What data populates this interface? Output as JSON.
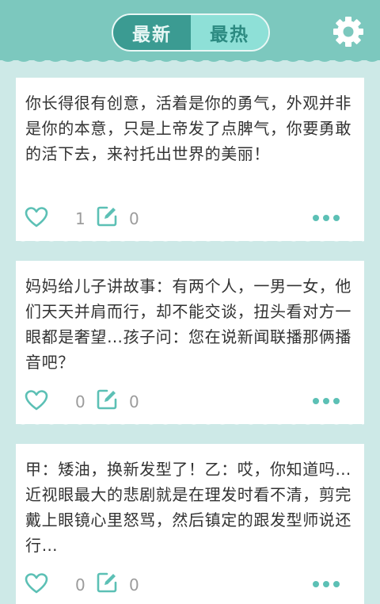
{
  "header": {
    "tabs": [
      {
        "label": "最新",
        "active": false
      },
      {
        "label": "最热",
        "active": true
      }
    ],
    "settings_icon": "gear-icon"
  },
  "colors": {
    "header_bg": "#7cc8be",
    "page_bg": "#cde9e7",
    "accent": "#5cc0b5",
    "tab_inactive_bg": "#3b9b92",
    "tab_active_bg": "#8ee0d7"
  },
  "posts": [
    {
      "text": "你长得很有创意，活着是你的勇气，外观并非是你的本意，只是上帝发了点脾气，你要勇敢的活下去，来衬托出世界的美丽！",
      "likes": "1",
      "comments": "0"
    },
    {
      "text": "妈妈给儿子讲故事：有两个人，一男一女，他们天天并肩而行，却不能交谈，扭头看对方一眼都是奢望…孩子问：您在说新闻联播那俩播音吧？",
      "likes": "0",
      "comments": "0"
    },
    {
      "text": "甲：矮油，换新发型了！乙：哎，你知道吗…近视眼最大的悲剧就是在理发时看不清，剪完戴上眼镜心里怒骂，然后镇定的跟发型师说还行…",
      "likes": "0",
      "comments": "0"
    }
  ]
}
